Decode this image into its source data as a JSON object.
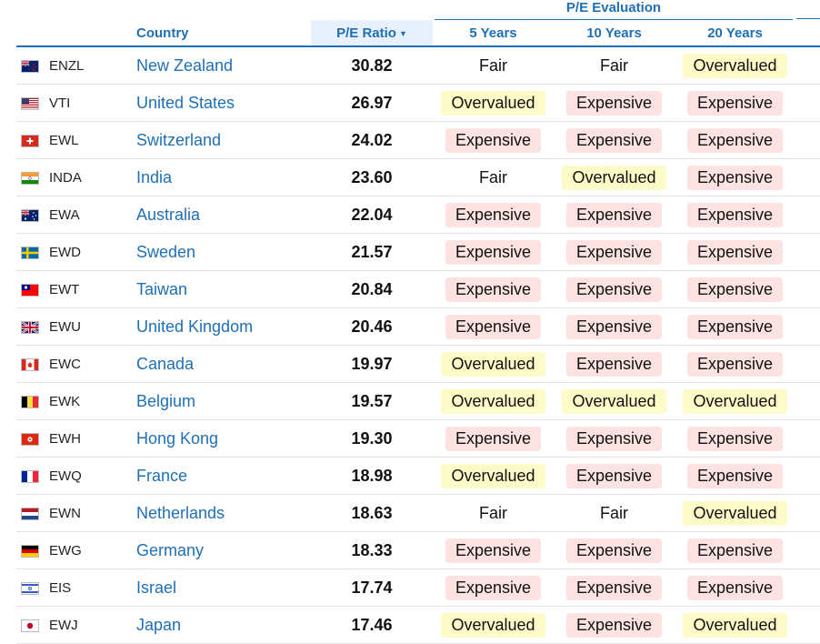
{
  "header": {
    "group_label": "P/E Evaluation",
    "columns": {
      "country": "Country",
      "pe_ratio": "P/E Ratio",
      "sort_indicator": "▼",
      "years5": "5 Years",
      "years10": "10 Years",
      "years20": "20 Years"
    }
  },
  "colors": {
    "accent": "#1f6fb5",
    "overvalued_bg": "#fdfbc8",
    "expensive_bg": "#fde2e2",
    "sorted_header_bg": "#e7f0fb"
  },
  "rows": [
    {
      "flag": "new-zealand",
      "ticker": "ENZL",
      "country": "New Zealand",
      "pe": "30.82",
      "y5": "Fair",
      "y10": "Fair",
      "y20": "Overvalued"
    },
    {
      "flag": "united-states",
      "ticker": "VTI",
      "country": "United States",
      "pe": "26.97",
      "y5": "Overvalued",
      "y10": "Expensive",
      "y20": "Expensive"
    },
    {
      "flag": "switzerland",
      "ticker": "EWL",
      "country": "Switzerland",
      "pe": "24.02",
      "y5": "Expensive",
      "y10": "Expensive",
      "y20": "Expensive"
    },
    {
      "flag": "india",
      "ticker": "INDA",
      "country": "India",
      "pe": "23.60",
      "y5": "Fair",
      "y10": "Overvalued",
      "y20": "Expensive"
    },
    {
      "flag": "australia",
      "ticker": "EWA",
      "country": "Australia",
      "pe": "22.04",
      "y5": "Expensive",
      "y10": "Expensive",
      "y20": "Expensive"
    },
    {
      "flag": "sweden",
      "ticker": "EWD",
      "country": "Sweden",
      "pe": "21.57",
      "y5": "Expensive",
      "y10": "Expensive",
      "y20": "Expensive"
    },
    {
      "flag": "taiwan",
      "ticker": "EWT",
      "country": "Taiwan",
      "pe": "20.84",
      "y5": "Expensive",
      "y10": "Expensive",
      "y20": "Expensive"
    },
    {
      "flag": "united-kingdom",
      "ticker": "EWU",
      "country": "United Kingdom",
      "pe": "20.46",
      "y5": "Expensive",
      "y10": "Expensive",
      "y20": "Expensive"
    },
    {
      "flag": "canada",
      "ticker": "EWC",
      "country": "Canada",
      "pe": "19.97",
      "y5": "Overvalued",
      "y10": "Expensive",
      "y20": "Expensive"
    },
    {
      "flag": "belgium",
      "ticker": "EWK",
      "country": "Belgium",
      "pe": "19.57",
      "y5": "Overvalued",
      "y10": "Overvalued",
      "y20": "Overvalued"
    },
    {
      "flag": "hong-kong",
      "ticker": "EWH",
      "country": "Hong Kong",
      "pe": "19.30",
      "y5": "Expensive",
      "y10": "Expensive",
      "y20": "Expensive"
    },
    {
      "flag": "france",
      "ticker": "EWQ",
      "country": "France",
      "pe": "18.98",
      "y5": "Overvalued",
      "y10": "Expensive",
      "y20": "Expensive"
    },
    {
      "flag": "netherlands",
      "ticker": "EWN",
      "country": "Netherlands",
      "pe": "18.63",
      "y5": "Fair",
      "y10": "Fair",
      "y20": "Overvalued"
    },
    {
      "flag": "germany",
      "ticker": "EWG",
      "country": "Germany",
      "pe": "18.33",
      "y5": "Expensive",
      "y10": "Expensive",
      "y20": "Expensive"
    },
    {
      "flag": "israel",
      "ticker": "EIS",
      "country": "Israel",
      "pe": "17.74",
      "y5": "Expensive",
      "y10": "Expensive",
      "y20": "Expensive"
    },
    {
      "flag": "japan",
      "ticker": "EWJ",
      "country": "Japan",
      "pe": "17.46",
      "y5": "Overvalued",
      "y10": "Expensive",
      "y20": "Overvalued"
    }
  ]
}
